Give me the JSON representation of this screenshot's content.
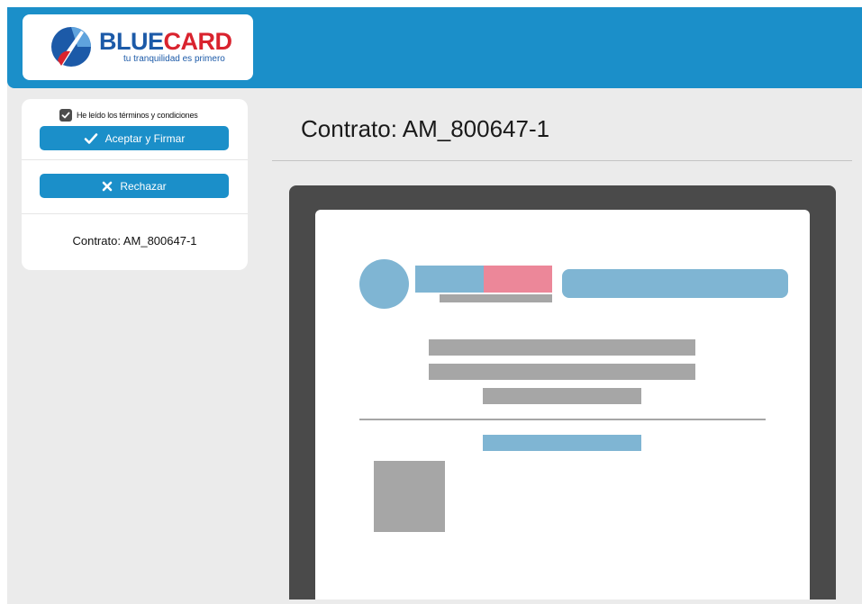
{
  "logo": {
    "brand_part1": "BLUE",
    "brand_part2": "CARD",
    "tagline": "tu tranquilidad es primero"
  },
  "sidebar": {
    "terms_label": "He leído los términos y condiciones",
    "terms_checked": true,
    "accept_label": "Aceptar y Firmar",
    "reject_label": "Rechazar",
    "contract_label": "Contrato: AM_800647-1"
  },
  "main": {
    "title": "Contrato: AM_800647-1"
  },
  "colors": {
    "header": "#1b8fc9",
    "button": "#1b8fc9",
    "viewer_frame": "#4a4a4a",
    "placeholder_blue": "#7fb5d3",
    "placeholder_pink": "#ec8799",
    "placeholder_gray": "#a6a6a6"
  }
}
